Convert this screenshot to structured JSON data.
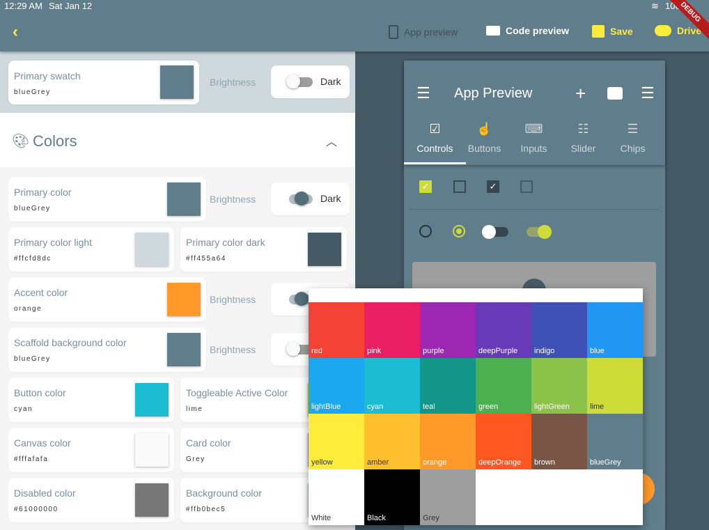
{
  "status": {
    "time": "12:29 AM",
    "date": "Sat Jan 12",
    "battery": "100%"
  },
  "debug_banner": "DEBUG",
  "toolbar": {
    "app_preview": "App preview",
    "code_preview": "Code preview",
    "save": "Save",
    "drive": "Drive"
  },
  "swatch": {
    "title": "Primary swatch",
    "value": "blueGrey",
    "color": "#607d8b",
    "brightness_label": "Brightness",
    "brightness_value": "Dark",
    "dark_on": false
  },
  "colors_section": {
    "title": "Colors"
  },
  "rows": [
    {
      "type": "wide",
      "title": "Primary color",
      "value": "blueGrey",
      "color": "#607d8b",
      "brightness_label": "Brightness",
      "brightness_value": "Dark",
      "dark_on": true
    },
    {
      "type": "pair",
      "items": [
        {
          "title": "Primary color light",
          "value": "#ffcfd8dc",
          "color": "#cfd8dc"
        },
        {
          "title": "Primary color dark",
          "value": "#ff455a64",
          "color": "#455a64"
        }
      ]
    },
    {
      "type": "wide",
      "title": "Accent color",
      "value": "orange",
      "color": "#ff9a2a",
      "brightness_label": "Brightness",
      "dark_on": true
    },
    {
      "type": "wide",
      "title": "Scaffold background color",
      "value": "blueGrey",
      "color": "#607d8b",
      "brightness_label": "Brightness",
      "dark_on": false
    },
    {
      "type": "pair",
      "items": [
        {
          "title": "Button color",
          "value": "cyan",
          "color": "#1cbcd2"
        },
        {
          "title": "Toggleable Active Color",
          "value": "lime",
          "color": "#cddc39"
        }
      ]
    },
    {
      "type": "pair",
      "items": [
        {
          "title": "Canvas color",
          "value": "#fffafafa",
          "color": "#fafafa"
        },
        {
          "title": "Card color",
          "value": "Grey",
          "color": "#9e9e9e"
        }
      ]
    },
    {
      "type": "pair",
      "items": [
        {
          "title": "Disabled color",
          "value": "#61000000",
          "color": "#777777"
        },
        {
          "title": "Background color",
          "value": "#ffb0bec5",
          "color": "#b0bec5"
        }
      ]
    }
  ],
  "preview": {
    "title": "App Preview",
    "tabs": [
      "Controls",
      "Buttons",
      "Inputs",
      "Slider",
      "Chips"
    ],
    "active_tab": "Controls"
  },
  "palette": [
    {
      "name": "red",
      "color": "#f44336",
      "text": "#fff"
    },
    {
      "name": "pink",
      "color": "#e91e63",
      "text": "#fff"
    },
    {
      "name": "purple",
      "color": "#9c27b0",
      "text": "#fff"
    },
    {
      "name": "deepPurple",
      "color": "#673ab7",
      "text": "#fff"
    },
    {
      "name": "indigo",
      "color": "#3f51b5",
      "text": "#fff"
    },
    {
      "name": "blue",
      "color": "#2196f3",
      "text": "#fff"
    },
    {
      "name": "lightBlue",
      "color": "#1ba8ef",
      "text": "#fff"
    },
    {
      "name": "cyan",
      "color": "#1cbcd2",
      "text": "#fff"
    },
    {
      "name": "teal",
      "color": "#139588",
      "text": "#fff"
    },
    {
      "name": "green",
      "color": "#4caf50",
      "text": "#fff"
    },
    {
      "name": "lightGreen",
      "color": "#8bc34a",
      "text": "#fff"
    },
    {
      "name": "lime",
      "color": "#cddc39",
      "text": "#333"
    },
    {
      "name": "yellow",
      "color": "#ffeb3b",
      "text": "#333"
    },
    {
      "name": "amber",
      "color": "#ffc030",
      "text": "#333"
    },
    {
      "name": "orange",
      "color": "#ff9a2a",
      "text": "#fff"
    },
    {
      "name": "deepOrange",
      "color": "#ff5722",
      "text": "#fff"
    },
    {
      "name": "brown",
      "color": "#795548",
      "text": "#fff"
    },
    {
      "name": "blueGrey",
      "color": "#607d8b",
      "text": "#fff"
    },
    {
      "name": "White",
      "color": "#ffffff",
      "text": "#333"
    },
    {
      "name": "Black",
      "color": "#000000",
      "text": "#fff"
    },
    {
      "name": "Grey",
      "color": "#9e9e9e",
      "text": "#333"
    }
  ]
}
